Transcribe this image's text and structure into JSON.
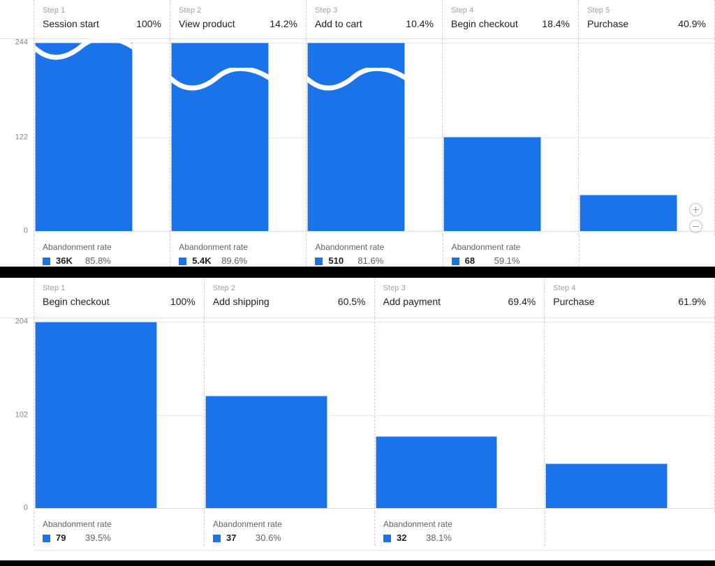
{
  "accent_color": "#1a73e8",
  "zoom_controls": {
    "zoom_in_label": "+",
    "zoom_out_label": "−",
    "zoom_in_name": "zoom-in-icon",
    "zoom_out_name": "zoom-out-icon"
  },
  "funnels": [
    {
      "id": "ecommerce-purchase-funnel",
      "footer_metric_label": "Abandonment rate",
      "steps": [
        {
          "ordinal": "Step 1",
          "name": "Session start",
          "completion": "100%",
          "abandon_count": "36K",
          "abandon_rate": "85.8%"
        },
        {
          "ordinal": "Step 2",
          "name": "View product",
          "completion": "14.2%",
          "abandon_count": "5.4K",
          "abandon_rate": "89.6%"
        },
        {
          "ordinal": "Step 3",
          "name": "Add to cart",
          "completion": "10.4%",
          "abandon_count": "510",
          "abandon_rate": "81.6%"
        },
        {
          "ordinal": "Step 4",
          "name": "Begin checkout",
          "completion": "18.4%",
          "abandon_count": "68",
          "abandon_rate": "59.1%"
        },
        {
          "ordinal": "Step 5",
          "name": "Purchase",
          "completion": "40.9%",
          "abandon_count": "",
          "abandon_rate": ""
        }
      ],
      "yticks": [
        "244",
        "122",
        "0"
      ]
    },
    {
      "id": "checkout-funnel",
      "footer_metric_label": "Abandonment rate",
      "steps": [
        {
          "ordinal": "Step 1",
          "name": "Begin checkout",
          "completion": "100%",
          "abandon_count": "79",
          "abandon_rate": "39.5%"
        },
        {
          "ordinal": "Step 2",
          "name": "Add shipping",
          "completion": "60.5%",
          "abandon_count": "37",
          "abandon_rate": "30.6%"
        },
        {
          "ordinal": "Step 3",
          "name": "Add payment",
          "completion": "69.4%",
          "abandon_count": "32",
          "abandon_rate": "38.1%"
        },
        {
          "ordinal": "Step 4",
          "name": "Purchase",
          "completion": "61.9%",
          "abandon_count": "",
          "abandon_rate": ""
        }
      ],
      "yticks": [
        "204",
        "102",
        "0"
      ]
    }
  ],
  "chart_data": [
    {
      "type": "bar",
      "title": "Ecommerce purchase funnel",
      "xlabel": "",
      "ylabel": "",
      "categories": [
        "Session start",
        "View product",
        "Add to cart",
        "Begin checkout",
        "Purchase"
      ],
      "step_labels": [
        "Step 1",
        "Step 2",
        "Step 3",
        "Step 4",
        "Step 5"
      ],
      "values": [
        244,
        244,
        244,
        122,
        47
      ],
      "truncated": [
        true,
        true,
        true,
        false,
        false
      ],
      "completion_rates": [
        "100%",
        "14.2%",
        "10.4%",
        "18.4%",
        "40.9%"
      ],
      "abandonment_counts": [
        "36K",
        "5.4K",
        "510",
        "68",
        null
      ],
      "abandonment_rates": [
        "85.8%",
        "89.6%",
        "81.6%",
        "59.1%",
        null
      ],
      "yticks": [
        0,
        122,
        244
      ],
      "ylim": [
        0,
        244
      ],
      "grid": true,
      "legend": "none",
      "series_color": "#1a73e8"
    },
    {
      "type": "bar",
      "title": "Checkout funnel",
      "xlabel": "",
      "ylabel": "",
      "categories": [
        "Begin checkout",
        "Add shipping",
        "Add payment",
        "Purchase"
      ],
      "step_labels": [
        "Step 1",
        "Step 2",
        "Step 3",
        "Step 4"
      ],
      "values": [
        204,
        123,
        79,
        49
      ],
      "truncated": [
        false,
        false,
        false,
        false
      ],
      "completion_rates": [
        "100%",
        "60.5%",
        "69.4%",
        "61.9%"
      ],
      "abandonment_counts": [
        "79",
        "37",
        "32",
        null
      ],
      "abandonment_rates": [
        "39.5%",
        "30.6%",
        "38.1%",
        null
      ],
      "yticks": [
        0,
        102,
        204
      ],
      "ylim": [
        0,
        204
      ],
      "grid": true,
      "legend": "none",
      "series_color": "#1a73e8"
    }
  ]
}
